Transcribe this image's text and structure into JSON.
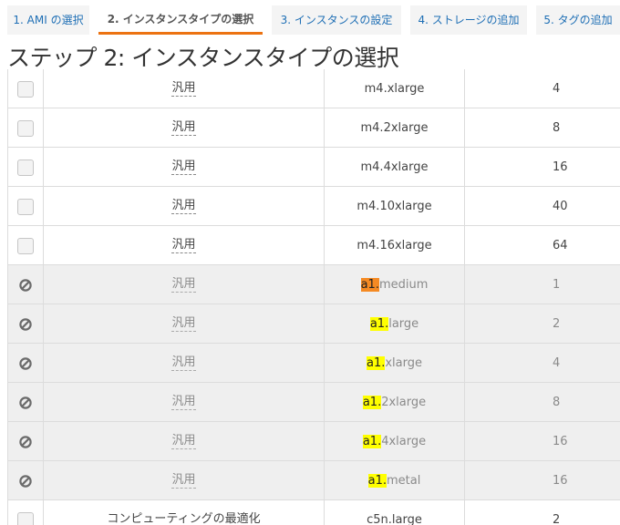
{
  "steps": [
    {
      "label": "1. AMI の選択",
      "active": false
    },
    {
      "label": "2. インスタンスタイプの選択",
      "active": true
    },
    {
      "label": "3. インスタンスの設定",
      "active": false
    },
    {
      "label": "4. ストレージの追加",
      "active": false
    },
    {
      "label": "5. タグの追加",
      "active": false
    }
  ],
  "page_title": "ステップ 2: インスタンスタイプの選択",
  "rows": [
    {
      "family": "汎用",
      "type_prefix": "",
      "type_rest": "m4.xlarge",
      "vcpus": "4",
      "disabled": false
    },
    {
      "family": "汎用",
      "type_prefix": "",
      "type_rest": "m4.2xlarge",
      "vcpus": "8",
      "disabled": false
    },
    {
      "family": "汎用",
      "type_prefix": "",
      "type_rest": "m4.4xlarge",
      "vcpus": "16",
      "disabled": false
    },
    {
      "family": "汎用",
      "type_prefix": "",
      "type_rest": "m4.10xlarge",
      "vcpus": "40",
      "disabled": false
    },
    {
      "family": "汎用",
      "type_prefix": "",
      "type_rest": "m4.16xlarge",
      "vcpus": "64",
      "disabled": false
    },
    {
      "family": "汎用",
      "type_prefix": "a1.",
      "type_rest": "medium",
      "vcpus": "1",
      "disabled": true,
      "current_match": true
    },
    {
      "family": "汎用",
      "type_prefix": "a1.",
      "type_rest": "large",
      "vcpus": "2",
      "disabled": true
    },
    {
      "family": "汎用",
      "type_prefix": "a1.",
      "type_rest": "xlarge",
      "vcpus": "4",
      "disabled": true
    },
    {
      "family": "汎用",
      "type_prefix": "a1.",
      "type_rest": "2xlarge",
      "vcpus": "8",
      "disabled": true
    },
    {
      "family": "汎用",
      "type_prefix": "a1.",
      "type_rest": "4xlarge",
      "vcpus": "16",
      "disabled": true
    },
    {
      "family": "汎用",
      "type_prefix": "a1.",
      "type_rest": "metal",
      "vcpus": "16",
      "disabled": true
    },
    {
      "family": "コンピューティングの最適化",
      "type_prefix": "",
      "type_rest": "c5n.large",
      "vcpus": "2",
      "disabled": false
    }
  ],
  "icons": {
    "disabled_row": "ban-icon",
    "selectable_row": "checkbox"
  },
  "colors": {
    "link": "#1f6fb5",
    "active_tab_underline": "#ec7211",
    "search_highlight": "#ffff00",
    "current_match_highlight": "#f58a23"
  }
}
